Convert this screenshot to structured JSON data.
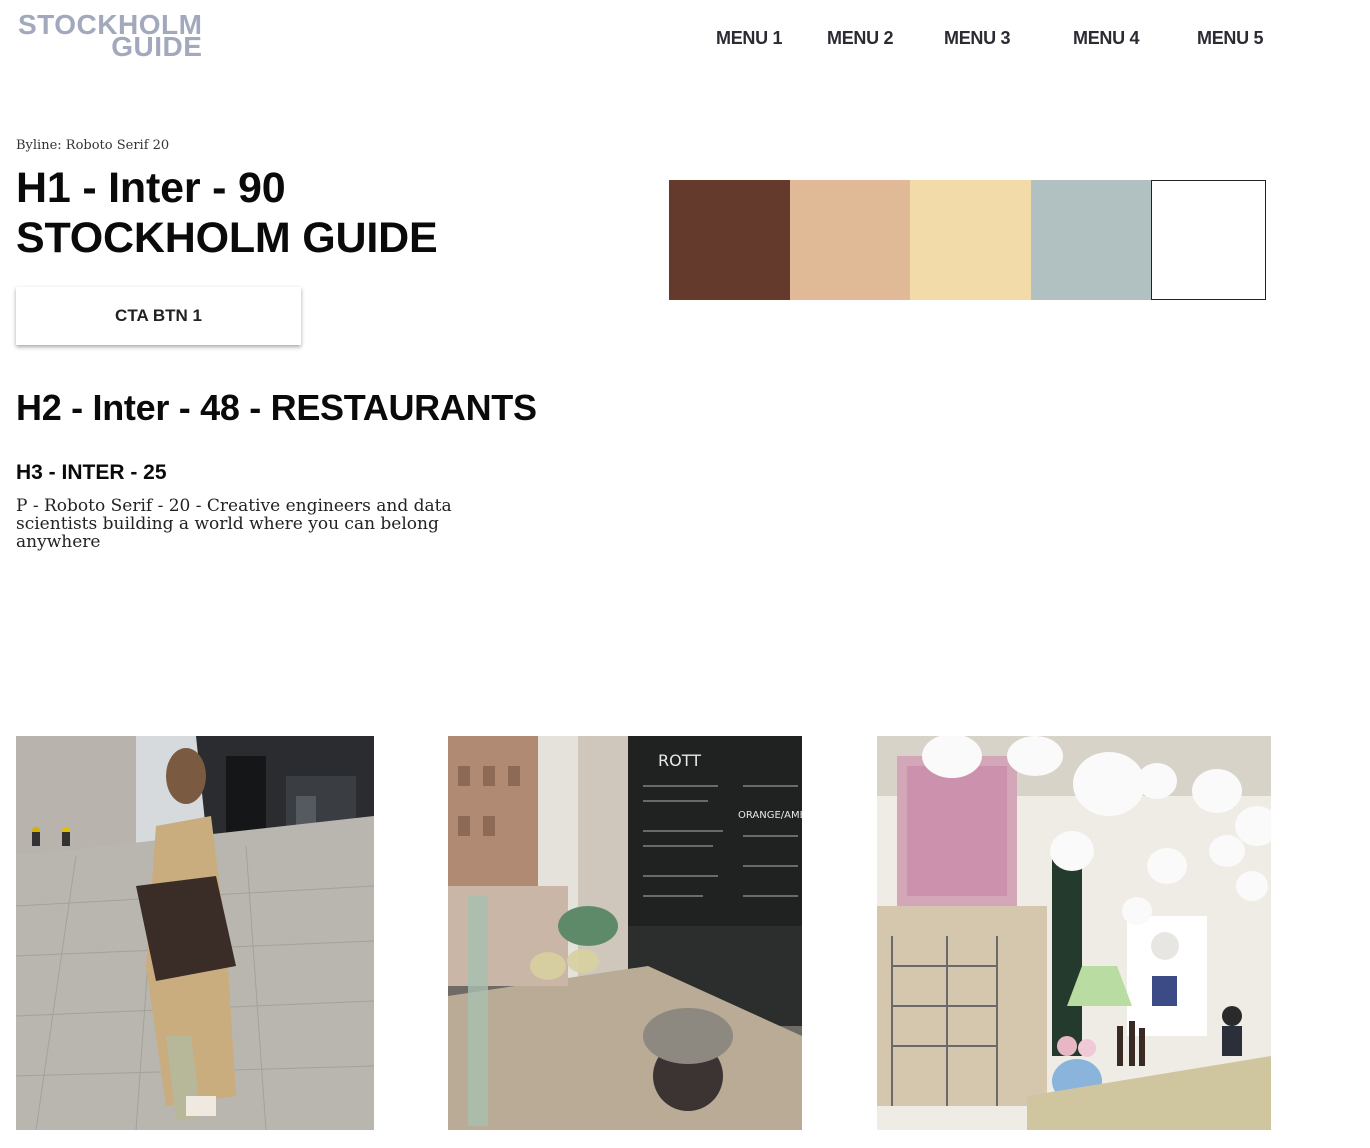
{
  "logo": {
    "line1": "STOCKHOLM",
    "line2": "GUIDE"
  },
  "nav": [
    "MENU 1",
    "MENU 2",
    "MENU 3",
    "MENU 4",
    "MENU 5"
  ],
  "hero": {
    "byline": "Byline: Roboto Serif 20",
    "h1_line1": "H1 - Inter - 90",
    "h1_line2": "STOCKHOLM GUIDE",
    "cta_label": "CTA BTN 1"
  },
  "content": {
    "h2": "H2 - Inter - 48 - RESTAURANTS",
    "h3": "H3 - INTER - 25",
    "paragraph": "P - Roboto Serif - 20 - Creative engineers and data scientists building a world where you can belong anywhere"
  },
  "palette": [
    "#643a2d",
    "#e0b996",
    "#f2dba8",
    "#b1c1c2",
    "#ffffff"
  ],
  "photos": [
    {
      "icon": "woman-street-photo"
    },
    {
      "icon": "wine-window-photo"
    },
    {
      "icon": "restaurant-lanterns-photo"
    }
  ],
  "photo_text": {
    "chalkboard": "ROTT",
    "orange": "ORANGE/AMBER"
  }
}
